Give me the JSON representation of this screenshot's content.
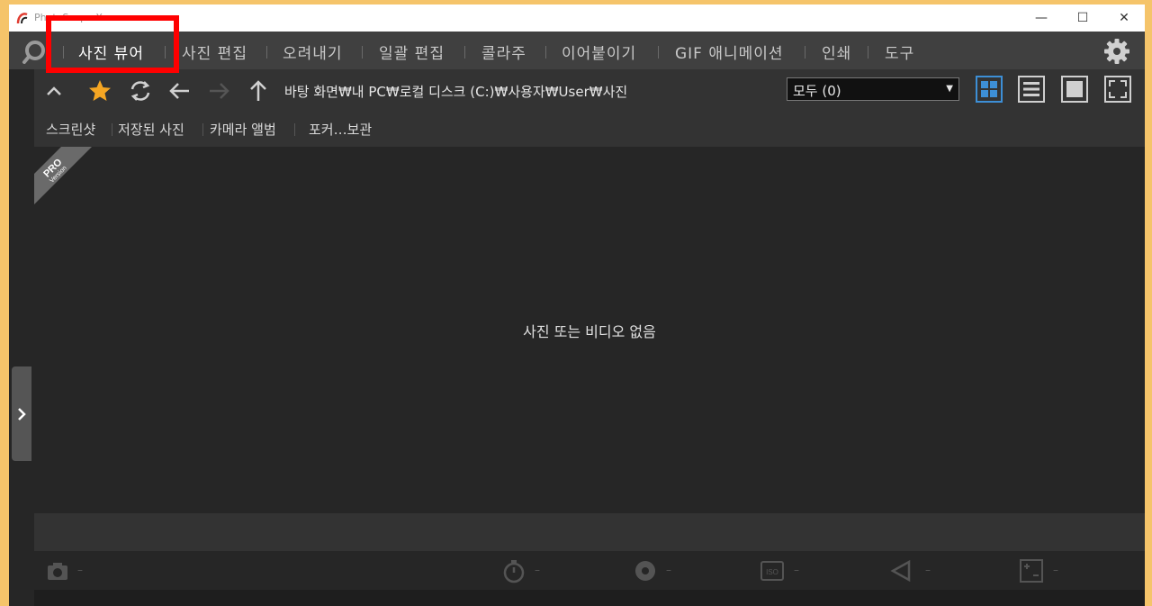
{
  "window": {
    "title": "PhotoScape X",
    "minimize": "—",
    "maximize": "☐",
    "close": "✕"
  },
  "menu": {
    "items": [
      "사진 뷰어",
      "사진 편집",
      "오려내기",
      "일괄 편집",
      "콜라주",
      "이어붙이기",
      "GIF 애니메이션",
      "인쇄",
      "도구"
    ],
    "active": "사진 뷰어"
  },
  "toolbar": {
    "path": "바탕 화면₩내 PC₩로컬 디스크 (C:)₩사용자₩User₩사진",
    "filter_value": "모두 (0)",
    "accent_color": "#3d8fd6",
    "star_color": "#f5a623"
  },
  "album_tabs": [
    "스크린샷",
    "저장된 사진",
    "카메라 앨범",
    "포커…보관"
  ],
  "badge": {
    "line1": "PRO",
    "line2": "Version"
  },
  "content": {
    "empty_message": "사진 또는 비디오 없음"
  },
  "info_bar": {
    "dash": "–"
  }
}
